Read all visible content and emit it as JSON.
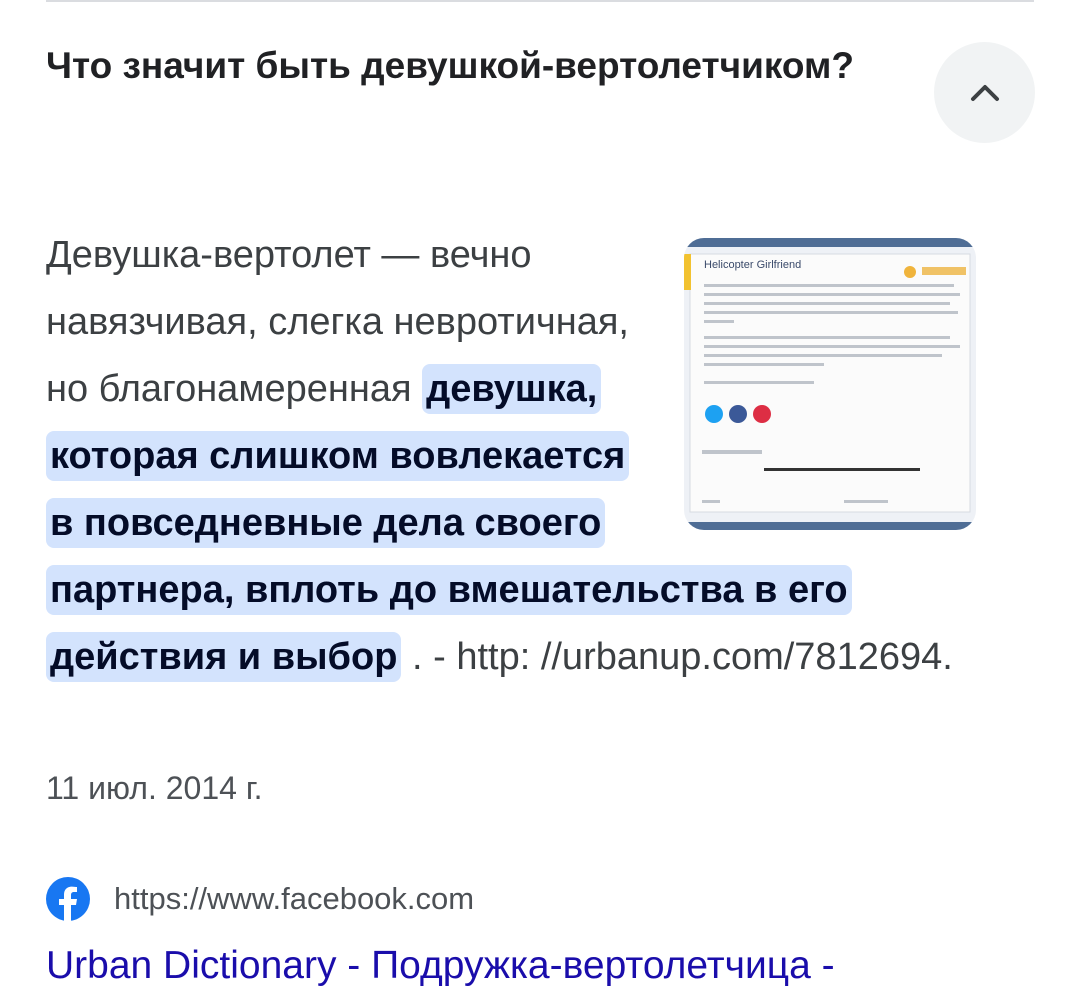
{
  "question": "Что значит быть девушкой-вертолетчиком?",
  "collapse_icon": "chevron-up-icon",
  "answer": {
    "plain_text": "Девушка-вертолет — вечно навязчивая, слегка невротичная, но благонамеренная ",
    "highlighted_text": "девушка, которая слишком вовлекается в повседневные дела своего партнера, вплоть до вмешательства в его действия и выбор",
    "suffix_text": " . - http: //urbanup.com/7812694."
  },
  "date": "11 июл. 2014 г.",
  "thumbnail": {
    "title": "Helicopter Girlfriend"
  },
  "source": {
    "icon": "facebook-icon",
    "brand_color": "#1877f2",
    "url": "https://www.facebook.com"
  },
  "result_title": "Urban Dictionary - Подружка-вертолетчица -",
  "colors": {
    "highlight_bg": "#d3e3fd",
    "link": "#1a0dab"
  }
}
